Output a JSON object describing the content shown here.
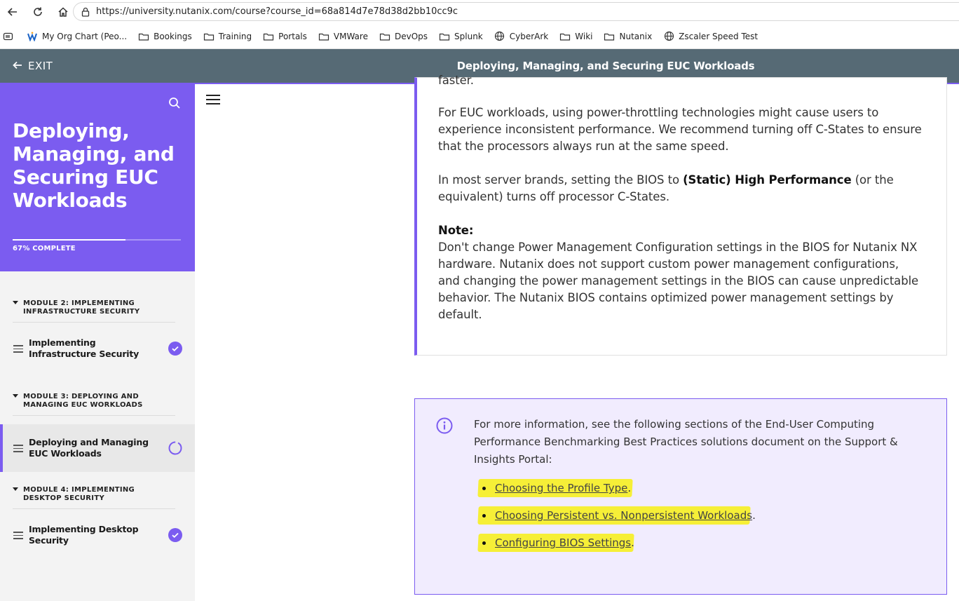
{
  "browser": {
    "url": "https://university.nutanix.com/course?course_id=68a814d7e78d38d2bb10cc9c",
    "bookmarks": [
      {
        "label": "My Org Chart (Peo...",
        "icon": "w-logo-icon"
      },
      {
        "label": "Bookings",
        "icon": "folder-icon"
      },
      {
        "label": "Training",
        "icon": "folder-icon"
      },
      {
        "label": "Portals",
        "icon": "folder-icon"
      },
      {
        "label": "VMWare",
        "icon": "folder-icon"
      },
      {
        "label": "DevOps",
        "icon": "folder-icon"
      },
      {
        "label": "Splunk",
        "icon": "folder-icon"
      },
      {
        "label": "CyberArk",
        "icon": "globe-icon"
      },
      {
        "label": "Wiki",
        "icon": "folder-icon"
      },
      {
        "label": "Nutanix",
        "icon": "folder-icon"
      },
      {
        "label": "Zscaler Speed Test",
        "icon": "globe-icon"
      }
    ]
  },
  "header": {
    "exit_label": "EXIT",
    "title": "Deploying, Managing, and Securing EUC Workloads"
  },
  "sidebar": {
    "title": "Deploying, Managing, and Securing EUC Workloads",
    "progress_label": "67% COMPLETE",
    "progress_fraction": 0.67,
    "modules": [
      {
        "title": "MODULE 2: IMPLEMENTING INFRASTRUCTURE SECURITY",
        "lesson": "Implementing Infrastructure Security",
        "status": "complete"
      },
      {
        "title": "MODULE 3: DEPLOYING AND MANAGING EUC WORKLOADS",
        "lesson": "Deploying and Managing EUC Workloads",
        "status": "in-progress"
      },
      {
        "title": "MODULE 4: IMPLEMENTING DESKTOP SECURITY",
        "lesson": "Implementing Desktop Security",
        "status": "complete"
      }
    ]
  },
  "content": {
    "cut_off_text": "faster.",
    "para1": "For EUC workloads, using power-throttling technologies might cause users to experience inconsistent performance. We recommend turning off C-States to ensure that the processors always run at the same speed.",
    "para2_pre": "In most server brands, setting the BIOS to ",
    "para2_bold": "(Static) High Performance",
    "para2_post": " (or the equivalent) turns off processor C-States.",
    "note_label": "Note:",
    "note_text": "Don't change Power Management Configuration settings in the BIOS for Nutanix NX hardware. Nutanix does not support custom power management configurations, and changing the power management settings in the BIOS can cause unpredictable behavior. The Nutanix BIOS contains optimized power management settings by default.",
    "info_text": "For more information, see the following sections of the End-User Computing Performance Benchmarking Best Practices solutions document on the Support & Insights Portal:",
    "links": [
      {
        "label": "Choosing the Profile Type",
        "punct": "."
      },
      {
        "label": "Choosing Persistent vs. Nonpersistent Workloads",
        "punct": "."
      },
      {
        "label": "Configuring BIOS Settings",
        "punct": "."
      }
    ]
  },
  "colors": {
    "accent": "#7b5cf0",
    "header_bg": "#566a75",
    "highlight": "#f5ef2c",
    "info_bg": "#f1ecfe"
  }
}
